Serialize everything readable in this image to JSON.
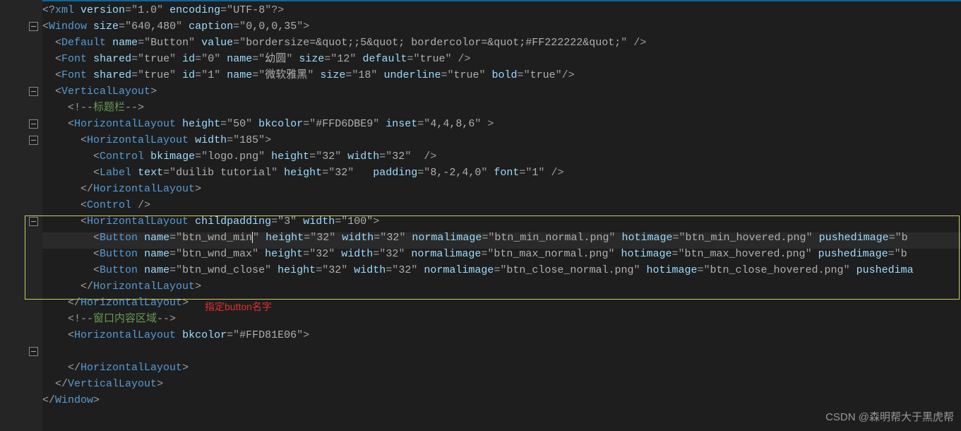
{
  "watermark": "CSDN @森明帮大于黑虎帮",
  "annotation": "指定button名字",
  "folds": [
    1,
    5,
    7,
    8,
    13,
    21
  ],
  "code": [
    {
      "i": 0,
      "t": "<?xml version=\"1.0\" encoding=\"UTF-8\"?>"
    },
    {
      "i": 0,
      "t": "<Window size=\"640,480\" caption=\"0,0,0,35\">"
    },
    {
      "i": 1,
      "t": "<Default name=\"Button\" value=\"bordersize=&quot;;5&quot; bordercolor=&quot;#FF222222&quot;\" />"
    },
    {
      "i": 1,
      "t": "<Font shared=\"true\" id=\"0\" name=\"幼圆\" size=\"12\" default=\"true\" />"
    },
    {
      "i": 1,
      "t": "<Font shared=\"true\" id=\"1\" name=\"微软雅黑\" size=\"18\" underline=\"true\" bold=\"true\"/>"
    },
    {
      "i": 1,
      "t": "<VerticalLayout>"
    },
    {
      "i": 2,
      "c": true,
      "t": "<!--标题栏-->"
    },
    {
      "i": 2,
      "t": "<HorizontalLayout height=\"50\" bkcolor=\"#FFD6DBE9\" inset=\"4,4,8,6\" >"
    },
    {
      "i": 3,
      "t": "<HorizontalLayout width=\"185\">"
    },
    {
      "i": 4,
      "t": "<Control bkimage=\"logo.png\" height=\"32\" width=\"32\"  />"
    },
    {
      "i": 4,
      "t": "<Label text=\"duilib tutorial\" height=\"32\"   padding=\"8,-2,4,0\" font=\"1\" />"
    },
    {
      "i": 3,
      "t": "</HorizontalLayout>"
    },
    {
      "i": 3,
      "t": "<Control />"
    },
    {
      "i": 3,
      "t": "<HorizontalLayout childpadding=\"3\" width=\"100\">"
    },
    {
      "i": 4,
      "cur": true,
      "t": "<Button name=\"btn_wnd_min|\" height=\"32\" width=\"32\" normalimage=\"btn_min_normal.png\" hotimage=\"btn_min_hovered.png\" pushedimage=\"bt"
    },
    {
      "i": 4,
      "t": "<Button name=\"btn_wnd_max\" height=\"32\" width=\"32\" normalimage=\"btn_max_normal.png\" hotimage=\"btn_max_hovered.png\" pushedimage=\"bt"
    },
    {
      "i": 4,
      "t": "<Button name=\"btn_wnd_close\" height=\"32\" width=\"32\" normalimage=\"btn_close_normal.png\" hotimage=\"btn_close_hovered.png\" pushedima"
    },
    {
      "i": 3,
      "t": "</HorizontalLayout>"
    },
    {
      "i": 2,
      "t": "</HorizontalLayout>"
    },
    {
      "i": 2,
      "c": true,
      "t": "<!--窗口内容区域-->"
    },
    {
      "i": 2,
      "t": "<HorizontalLayout bkcolor=\"#FFD81E06\">"
    },
    {
      "i": 2,
      "t": ""
    },
    {
      "i": 2,
      "t": "</HorizontalLayout>"
    },
    {
      "i": 1,
      "t": "</VerticalLayout>"
    },
    {
      "i": 0,
      "t": "</Window>"
    }
  ]
}
